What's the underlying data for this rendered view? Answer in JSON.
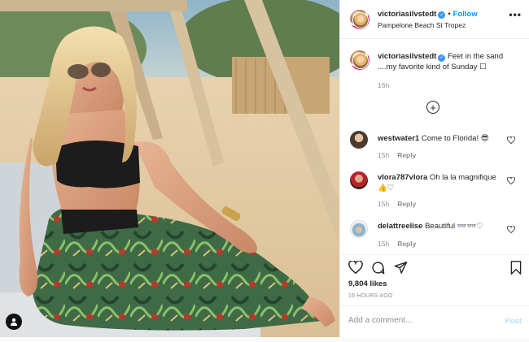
{
  "post": {
    "username": "victoriasilvstedt",
    "verified": true,
    "follow_label": "Follow",
    "separator": "•",
    "location": "Pampelone Beach St Tropez",
    "more_icon": "more-horizontal-icon",
    "caption_text": "Feet in the sand ....my favorite kind of Sunday ☐",
    "caption_time": "16h",
    "load_more_icon": "plus-circle-icon"
  },
  "comments": [
    {
      "username": "westwater1",
      "text": "Come to Florida! 😎",
      "time": "15h",
      "reply": "Reply"
    },
    {
      "username": "vlora787vlora",
      "text": "Oh la la magnifique 👍♡",
      "time": "15h",
      "reply": "Reply"
    },
    {
      "username": "delattreelise",
      "text": "Beautiful 👓👓♡",
      "time": "15h",
      "reply": "Reply"
    }
  ],
  "footer": {
    "likes": "9,804 likes",
    "posted_ago": "16 HOURS AGO",
    "add_comment_placeholder": "Add a comment...",
    "post_label": "Post"
  },
  "colors": {
    "accent_blue": "#0095f6",
    "verified_blue": "#3897f0",
    "post_disabled": "#b2dffc",
    "muted_text": "#8e8e8e"
  }
}
